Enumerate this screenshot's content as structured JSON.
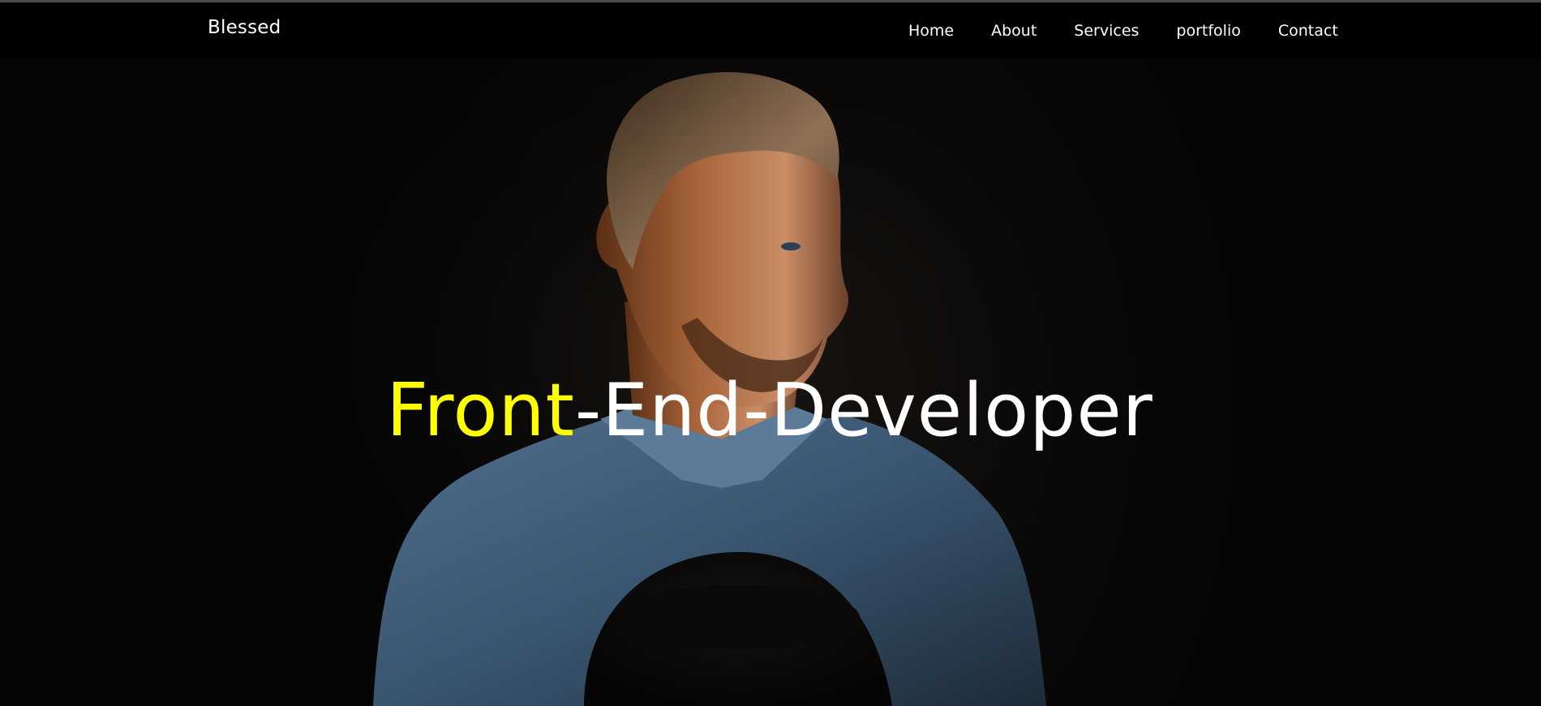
{
  "nav": {
    "brand": "Blessed",
    "links": [
      {
        "label": "Home"
      },
      {
        "label": "About"
      },
      {
        "label": "Services"
      },
      {
        "label": "portfolio"
      },
      {
        "label": "Contact"
      }
    ]
  },
  "hero": {
    "title_highlight": "Front",
    "title_rest": "-End-Developer",
    "scroll_icon": "chevron-down-icon"
  },
  "colors": {
    "accent": "#ffff00",
    "navbar": "#000000",
    "text": "#ffffff"
  }
}
